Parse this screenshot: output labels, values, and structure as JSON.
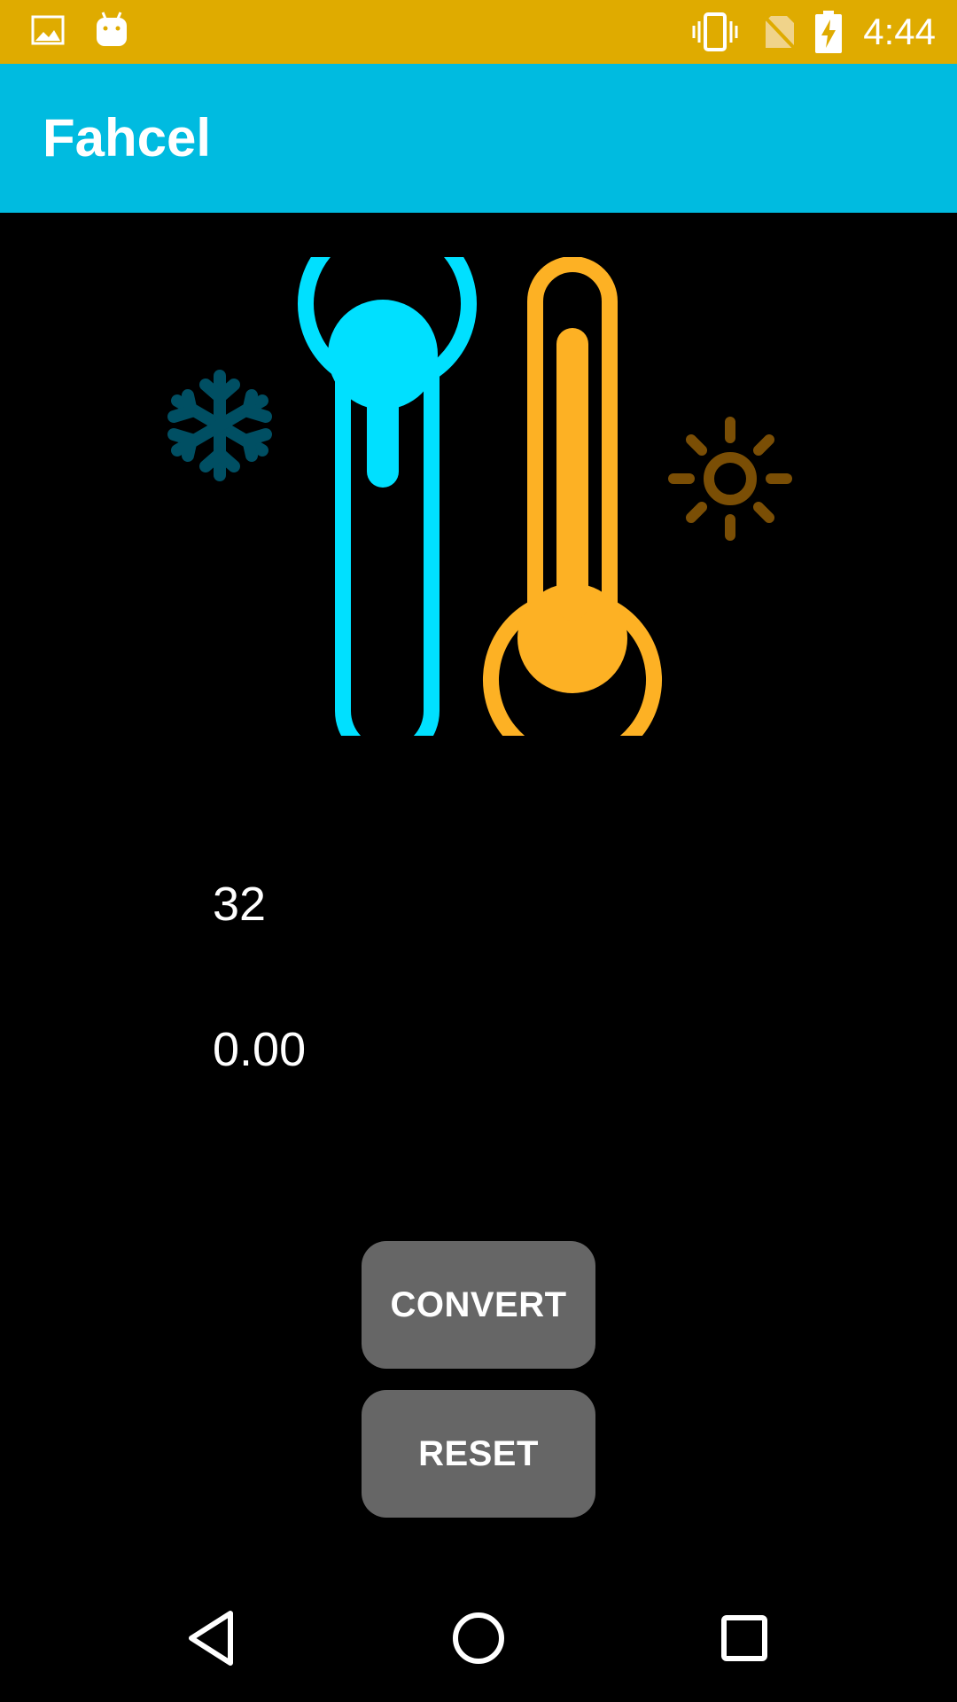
{
  "status_bar": {
    "time": "4:44",
    "background": "#dfab00",
    "icons": [
      "gallery-icon",
      "android-icon",
      "vibrate-icon",
      "no-sim-icon",
      "battery-charging-icon"
    ]
  },
  "app_bar": {
    "title": "Fahcel",
    "background": "#00bbe0"
  },
  "hero": {
    "icons": [
      "snowflake-icon",
      "cold-thermometer-icon",
      "hot-thermometer-icon",
      "sun-icon"
    ],
    "cold_color": "#00e0ff",
    "hot_color": "#fdb124"
  },
  "main": {
    "input_value": "32",
    "output_value": "0.00"
  },
  "buttons": {
    "convert_label": "CONVERT",
    "reset_label": "RESET",
    "background": "#666666"
  },
  "nav_bar": {
    "icons": [
      "back-icon",
      "home-icon",
      "recents-icon"
    ]
  }
}
